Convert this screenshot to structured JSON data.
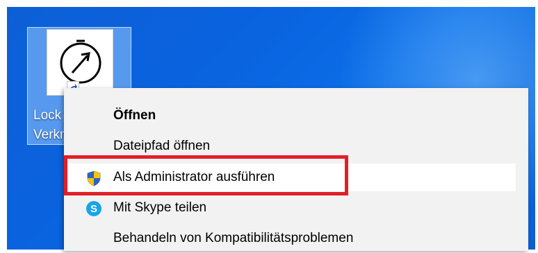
{
  "desktop": {
    "icon": {
      "name": "stopwatch-shortcut",
      "label": "Lock\nVerkn",
      "overlay": "shortcut-arrow-icon"
    }
  },
  "context_menu": {
    "items": [
      {
        "label": "Öffnen",
        "bold": true
      },
      {
        "label": "Dateipfad öffnen"
      },
      {
        "label": "Als Administrator ausführen",
        "icon": "uac-shield-icon",
        "highlighted": true
      },
      {
        "label": "Mit Skype teilen",
        "icon": "skype-icon"
      },
      {
        "label": "Behandeln von Kompatibilitätsproblemen"
      }
    ]
  },
  "colors": {
    "highlight_border": "#e41e26",
    "menu_background": "#f2f2f2",
    "desktop_blue": "#0b63df"
  }
}
